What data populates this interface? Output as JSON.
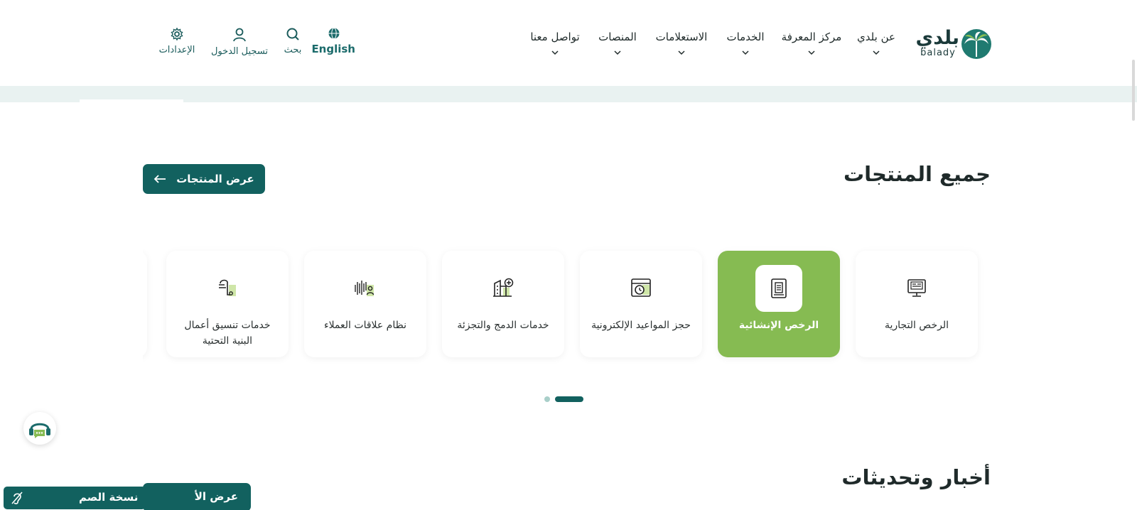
{
  "header": {
    "logo": {
      "arabic": "بلدي",
      "latin": "balady"
    },
    "nav": [
      {
        "label": "عن بلدي"
      },
      {
        "label": "مركز المعرفة"
      },
      {
        "label": "الخدمات"
      },
      {
        "label": "الاستعلامات"
      },
      {
        "label": "المنصات"
      },
      {
        "label": "تواصل معنا"
      }
    ],
    "utilities": {
      "language": "English",
      "search": "بحث",
      "login": "تسجيل الدخول",
      "settings": "الإعدادات"
    }
  },
  "products": {
    "title": "جميع المنتجات",
    "view_all": "عرض المنتجات",
    "cards": [
      {
        "label": "الرخص التجارية",
        "icon": "commercial-license-icon",
        "active": false
      },
      {
        "label": "الرخص الإنشائية",
        "icon": "construction-license-icon",
        "active": true
      },
      {
        "label": "حجز المواعيد الإلكترونية",
        "icon": "appointment-booking-icon",
        "active": false
      },
      {
        "label": "خدمات الدمج والتجزئة",
        "icon": "merge-split-building-icon",
        "active": false
      },
      {
        "label": "نظام علاقات العملاء",
        "icon": "customer-relations-icon",
        "active": false
      },
      {
        "label": "خدمات تنسيق أعمال البنية التحتية",
        "icon": "infrastructure-coordination-icon",
        "active": false
      }
    ],
    "pagination": {
      "pages": 2,
      "current": 2
    }
  },
  "news": {
    "title": "أخبار وتحديثات",
    "button_partial": "عرض الأ"
  },
  "floating": {
    "deaf_version": "نسخة الصم",
    "chat": "support-chat-icon"
  },
  "colors": {
    "primary": "#12615f",
    "active_card": "#86bb52",
    "band": "#e9f2f1"
  }
}
